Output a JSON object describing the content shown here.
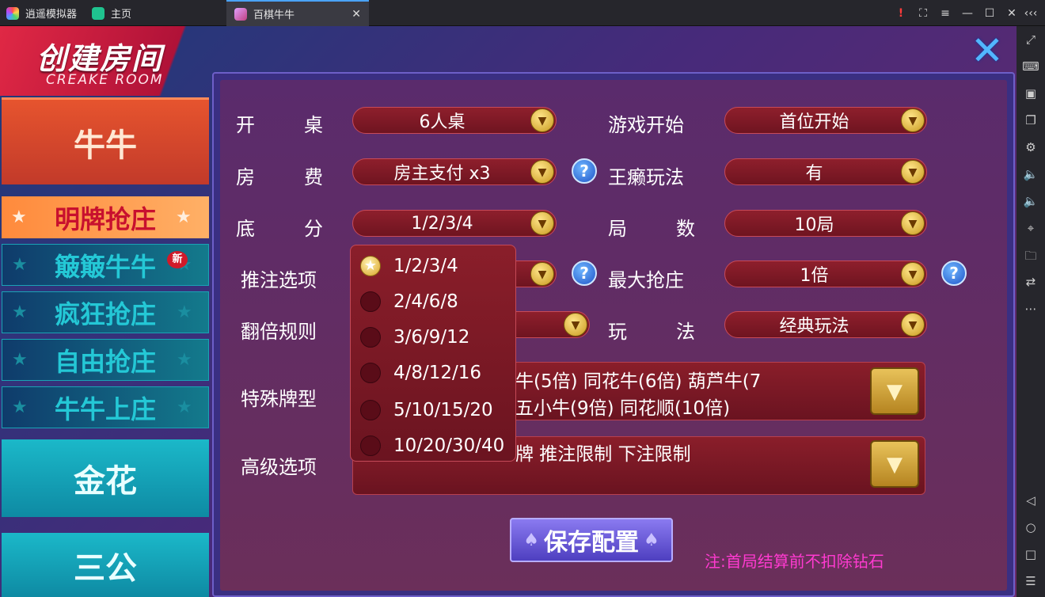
{
  "titlebar": {
    "app_name": "逍遥模拟器",
    "home_tab": "主页",
    "game_tab": "百棋牛牛",
    "close_glyph": "✕",
    "controls": [
      "!",
      "⛶",
      "≡",
      "—",
      "☐",
      "✕"
    ]
  },
  "sidetools": [
    "⤢",
    "⌨",
    "▣",
    "❐",
    "⚙",
    "🔈",
    "🔈",
    "⌖",
    "🗀",
    "⇄",
    "⋯",
    "◁",
    "○",
    "□",
    "☰"
  ],
  "header": {
    "title": "创建房间",
    "subtitle": "CREAKE ROOM",
    "close": "✕"
  },
  "games": {
    "niuniu": "牛牛",
    "jinhua": "金花",
    "sangong": "三公",
    "subs": [
      {
        "label": "明牌抢庄",
        "active": true
      },
      {
        "label": "簸簸牛牛",
        "active": false,
        "badge": "新"
      },
      {
        "label": "疯狂抢庄",
        "active": false
      },
      {
        "label": "自由抢庄",
        "active": false
      },
      {
        "label": "牛牛上庄",
        "active": false
      }
    ],
    "star": "★"
  },
  "form": {
    "table": {
      "label": [
        "开",
        "桌"
      ],
      "value": "6人桌"
    },
    "start": {
      "label": "游戏开始",
      "value": "首位开始"
    },
    "fee": {
      "label": [
        "房",
        "费"
      ],
      "value": "房主支付 x3"
    },
    "wildcard": {
      "label": "王癞玩法",
      "value": "有"
    },
    "base": {
      "label": [
        "底",
        "分"
      ],
      "value": "1/2/3/4"
    },
    "rounds": {
      "label": [
        "局",
        "数"
      ],
      "value": "10局"
    },
    "push": {
      "label": "推注选项"
    },
    "maxbank": {
      "label": "最大抢庄",
      "value": "1倍"
    },
    "double": {
      "label": "翻倍规则"
    },
    "play": {
      "label": [
        "玩",
        "法"
      ],
      "value": "经典玩法"
    },
    "special": {
      "label": "特殊牌型",
      "line1": "牛(5倍)  同花牛(6倍)  葫芦牛(7",
      "line2": "五小牛(9倍)  同花顺(10倍)"
    },
    "advanced": {
      "label": "高级选项",
      "line1": "牌  推注限制  下注限制"
    },
    "help": "?",
    "arrow": "▼"
  },
  "dropdown": {
    "options": [
      "1/2/3/4",
      "2/4/6/8",
      "3/6/9/12",
      "4/8/12/16",
      "5/10/15/20",
      "10/20/30/40"
    ],
    "selected_index": 0,
    "selected_mark": "★"
  },
  "save": {
    "label": "保存配置",
    "spade": "♠"
  },
  "note": "注:首局结算前不扣除钻石"
}
